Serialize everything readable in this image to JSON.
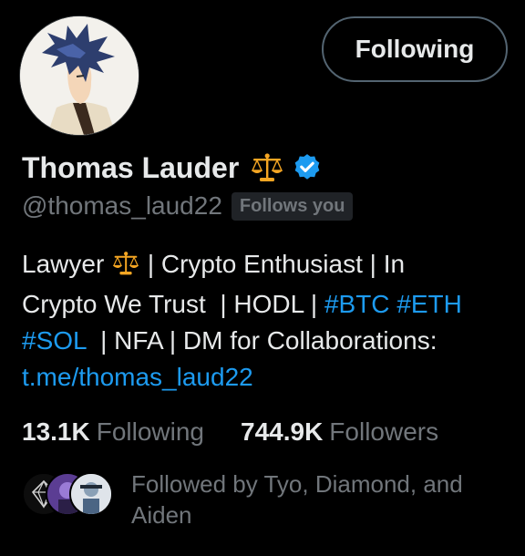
{
  "profile": {
    "name": "Thomas Lauder",
    "handle": "@thomas_laud22",
    "follows_you_badge": "Follows you",
    "verified": true,
    "name_emoji_icon": "balance-scale-icon"
  },
  "follow_button": {
    "label": "Following"
  },
  "bio": {
    "line1_a": "Lawyer ",
    "line1_b": " | Crypto Enthusiast | In",
    "line2_a": "Crypto We Trust  | HODL | ",
    "hashtag_btc": "#BTC",
    "hashtag_eth": "#ETH",
    "hashtag_sol": "#SOL",
    "line3_b": "  | NFA | DM for Collaborations:",
    "link": "t.me/thomas_laud22"
  },
  "stats": {
    "following_count": "13.1K",
    "following_label": "Following",
    "followers_count": "744.9K",
    "followers_label": "Followers"
  },
  "followed_by": {
    "text": "Followed by Tyo, Diamond, and Aiden"
  },
  "colors": {
    "background": "#000000",
    "text_primary": "#e7e9ea",
    "text_secondary": "#71767b",
    "accent": "#1d9bf0",
    "badge_bg": "#202327"
  }
}
